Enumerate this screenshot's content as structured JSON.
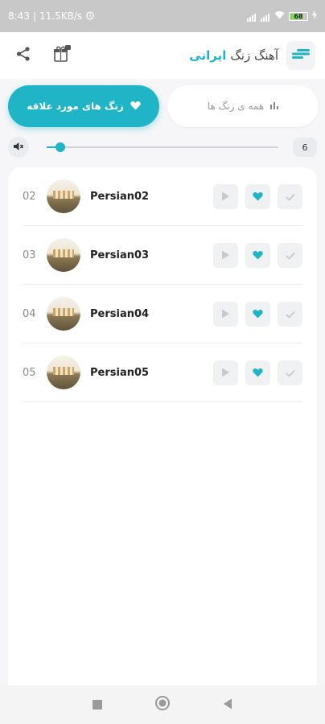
{
  "status": {
    "time": "8:43",
    "speed": "11.5KB/s",
    "battery_level": "68"
  },
  "header": {
    "title_prefix": "آهنگ زنگ",
    "title_brand": "ایرانی",
    "icons": [
      "share-icon",
      "gift-icon",
      "menu-icon"
    ]
  },
  "tabs": {
    "favorites_label": "زنگ های مورد علاقه",
    "all_label": "همه ی زنگ ها"
  },
  "volume": {
    "value": "6",
    "fraction": 0.06
  },
  "ringtones": [
    {
      "num": "02",
      "title": "Persian02"
    },
    {
      "num": "03",
      "title": "Persian03"
    },
    {
      "num": "04",
      "title": "Persian04"
    },
    {
      "num": "05",
      "title": "Persian05"
    }
  ],
  "colors": {
    "accent": "#1fb4c6",
    "background": "#f6f6f8"
  }
}
